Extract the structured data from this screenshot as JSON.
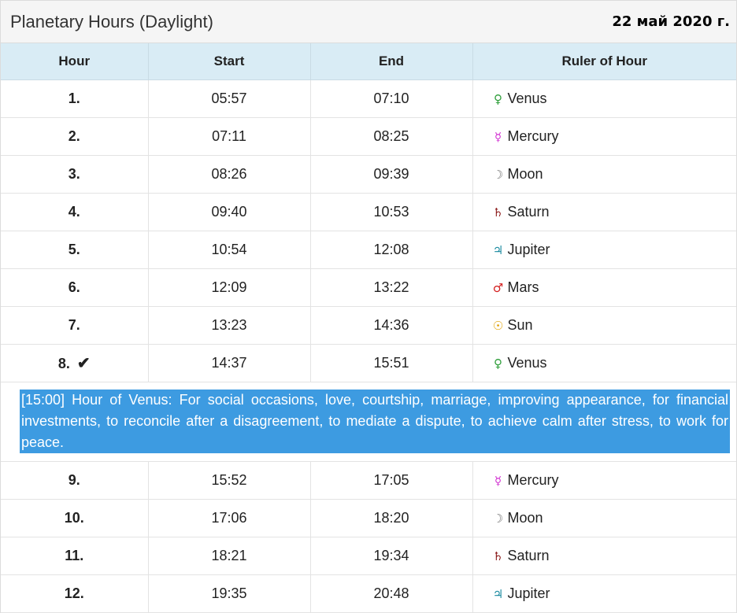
{
  "header": {
    "title": "Planetary Hours (Daylight)",
    "date": "22 май 2020 г."
  },
  "columns": [
    "Hour",
    "Start",
    "End",
    "Ruler of Hour"
  ],
  "rows_top": [
    {
      "hour": "1.",
      "start": "05:57",
      "end": "07:10",
      "symbol": "♀",
      "ruler": "Venus",
      "color": "#2e9e3a",
      "icon": "venus-icon"
    },
    {
      "hour": "2.",
      "start": "07:11",
      "end": "08:25",
      "symbol": "☿",
      "ruler": "Mercury",
      "color": "#d12fd1",
      "icon": "mercury-icon"
    },
    {
      "hour": "3.",
      "start": "08:26",
      "end": "09:39",
      "symbol": "☽",
      "ruler": "Moon",
      "color": "#777777",
      "icon": "moon-icon"
    },
    {
      "hour": "4.",
      "start": "09:40",
      "end": "10:53",
      "symbol": "♄",
      "ruler": "Saturn",
      "color": "#8b1a1a",
      "icon": "saturn-icon"
    },
    {
      "hour": "5.",
      "start": "10:54",
      "end": "12:08",
      "symbol": "♃",
      "ruler": "Jupiter",
      "color": "#1a8aa0",
      "icon": "jupiter-icon"
    },
    {
      "hour": "6.",
      "start": "12:09",
      "end": "13:22",
      "symbol": "♂",
      "ruler": "Mars",
      "color": "#d42020",
      "icon": "mars-icon"
    },
    {
      "hour": "7.",
      "start": "13:23",
      "end": "14:36",
      "symbol": "☉",
      "ruler": "Sun",
      "color": "#e0a000",
      "icon": "sun-icon"
    },
    {
      "hour": "8.",
      "start": "14:37",
      "end": "15:51",
      "symbol": "♀",
      "ruler": "Venus",
      "color": "#2e9e3a",
      "icon": "venus-icon",
      "current": true,
      "check": "✔"
    }
  ],
  "note": "[15:00] Hour of Venus: For social occasions, love, courtship, marriage, improving appearance, for financial investments, to reconcile after a disagreement, to mediate a dispute, to achieve calm after stress, to work for peace.",
  "rows_bottom": [
    {
      "hour": "9.",
      "start": "15:52",
      "end": "17:05",
      "symbol": "☿",
      "ruler": "Mercury",
      "color": "#d12fd1",
      "icon": "mercury-icon"
    },
    {
      "hour": "10.",
      "start": "17:06",
      "end": "18:20",
      "symbol": "☽",
      "ruler": "Moon",
      "color": "#777777",
      "icon": "moon-icon"
    },
    {
      "hour": "11.",
      "start": "18:21",
      "end": "19:34",
      "symbol": "♄",
      "ruler": "Saturn",
      "color": "#8b1a1a",
      "icon": "saturn-icon"
    },
    {
      "hour": "12.",
      "start": "19:35",
      "end": "20:48",
      "symbol": "♃",
      "ruler": "Jupiter",
      "color": "#1a8aa0",
      "icon": "jupiter-icon"
    }
  ]
}
